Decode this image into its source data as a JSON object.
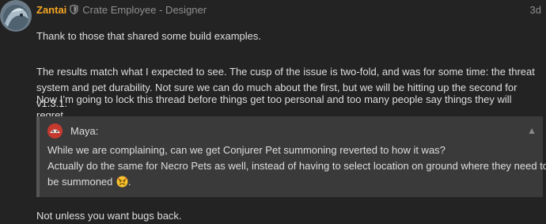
{
  "post": {
    "username": "Zantai",
    "user_title": "Crate Employee - Designer",
    "date": "3d",
    "paragraphs": {
      "p1": "Thank to those that shared some build examples.",
      "p2": "The results match what I expected to see. The cusp of the issue is two-fold, and was for some time: the threat system and pet durability. Not sure we can do much about the first, but we will be hitting up the second for v1.3.1.",
      "p3": "Now I’m going to lock this thread before things get too personal and too many people say things they will regret.",
      "p4": "Not unless you want bugs back."
    }
  },
  "quote": {
    "author": "Maya:",
    "line1": "While we are complaining, can we get Conjurer Pet summoning reverted to how it was?",
    "line2": "Actually do the same for Necro Pets as well, instead of having to select location on ground where they need to",
    "line3": "be summoned",
    "line3_end": ".",
    "emoji": "angry-face-icon",
    "expand_icon": "▲"
  },
  "colors": {
    "username": "#f5a623",
    "background": "#232323",
    "quote_background": "#3a3a3a",
    "quote_border": "#555555",
    "muted_text": "#8f8f8f"
  },
  "icons": {
    "avatar": "avatar-icon",
    "staff_badge": "shield-icon"
  }
}
